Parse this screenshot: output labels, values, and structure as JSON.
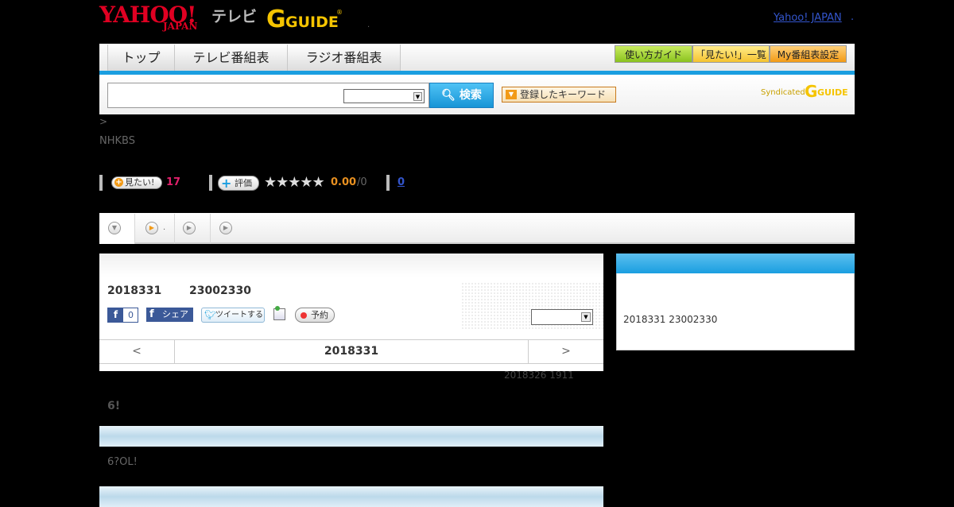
{
  "header": {
    "logo_yahoo": "YAHOO!",
    "logo_japan": "JAPAN",
    "logo_tv": "テレビ",
    "logo_gguide": "G GUIDE",
    "dot": ".",
    "yahoo_japan_link": "Yahoo! JAPAN",
    "link_dot": "."
  },
  "nav": {
    "tabs": [
      "トップ",
      "テレビ番組表",
      "ラジオ番組表"
    ],
    "buttons": [
      "使い方ガイド",
      "「見たい!」一覧",
      "My番組表設定"
    ]
  },
  "search": {
    "input_value": "",
    "select_value": "",
    "button_label": "検索",
    "keyword_button": "登録したキーワード",
    "syndicated": "Syndicated",
    "gguide_small": "GUIDE"
  },
  "breadcrumb": ">",
  "station": "NHKBS",
  "stats": {
    "mitai_label": "見たい!",
    "mitai_count": "17",
    "hyoka_label": "評価",
    "stars": "★★★★★",
    "rating": "0.00",
    "rating_den": "/0",
    "comments": "0"
  },
  "tabs": {
    "tab2_dot": "."
  },
  "program": {
    "date": "2018331",
    "time": "23002330",
    "fb_count": "0",
    "fb_share": "シェア",
    "tweet": "ツイートする",
    "record": "予約",
    "select_value": ""
  },
  "date_nav": {
    "prev": "<",
    "current": "2018331",
    "next": ">"
  },
  "updated": "2018326  1911",
  "headline": "6!",
  "description": "6?OL!",
  "right_box": {
    "text": "2018331  23002330"
  },
  "colors": {
    "accent_blue": "#1a9ee0",
    "yahoo_red": "#e00022",
    "mitai_pink": "#e0206b",
    "rating_orange": "#e89020"
  }
}
